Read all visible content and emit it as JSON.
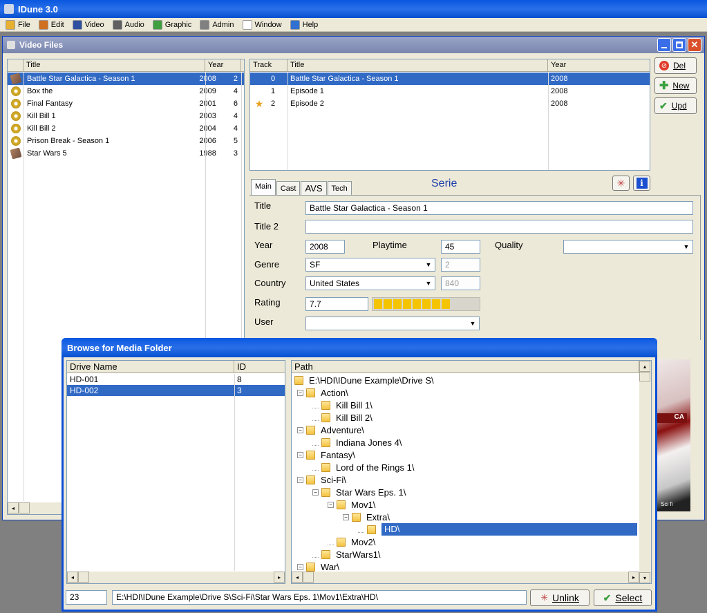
{
  "app": {
    "title": "IDune 3.0"
  },
  "menu": [
    {
      "label": "File",
      "icon": "folder-icon",
      "color": "#e8b030"
    },
    {
      "label": "Edit",
      "icon": "edit-icon",
      "color": "#d07020"
    },
    {
      "label": "Video",
      "icon": "film-icon",
      "color": "#3050a0"
    },
    {
      "label": "Audio",
      "icon": "music-icon",
      "color": "#606060"
    },
    {
      "label": "Graphic",
      "icon": "image-icon",
      "color": "#40a040"
    },
    {
      "label": "Admin",
      "icon": "tools-icon",
      "color": "#808080"
    },
    {
      "label": "Window",
      "icon": "window-icon",
      "color": "#ffffff"
    },
    {
      "label": "Help",
      "icon": "help-icon",
      "color": "#3070d0"
    }
  ],
  "video_window": {
    "title": "Video Files"
  },
  "video_list": {
    "headers": [
      "Title",
      "Year",
      ""
    ],
    "rows": [
      {
        "title": "Battle Star Galactica - Season 1",
        "year": "2008",
        "extra": "2",
        "icon": "hdd-icon",
        "selected": true
      },
      {
        "title": "Box the",
        "year": "2009",
        "extra": "4",
        "icon": "disc-icon",
        "selected": false
      },
      {
        "title": "Final Fantasy",
        "year": "2001",
        "extra": "6",
        "icon": "disc-icon",
        "selected": false
      },
      {
        "title": "Kill Bill 1",
        "year": "2003",
        "extra": "4",
        "icon": "disc-icon",
        "selected": false
      },
      {
        "title": "Kill Bill 2",
        "year": "2004",
        "extra": "4",
        "icon": "disc-icon",
        "selected": false
      },
      {
        "title": "Prison Break - Season 1",
        "year": "2006",
        "extra": "5",
        "icon": "disc-icon",
        "selected": false
      },
      {
        "title": "Star Wars 5",
        "year": "1988",
        "extra": "3",
        "icon": "hdd-icon",
        "selected": false
      }
    ]
  },
  "track_list": {
    "headers": [
      "Track",
      "Title",
      "Year"
    ],
    "rows": [
      {
        "track": "0",
        "title": "Battle Star Galactica - Season 1",
        "year": "2008",
        "selected": true,
        "star": false
      },
      {
        "track": "1",
        "title": "Episode 1",
        "year": "2008",
        "selected": false,
        "star": false
      },
      {
        "track": "2",
        "title": "Episode 2",
        "year": "2008",
        "selected": false,
        "star": true
      }
    ]
  },
  "buttons": {
    "del": "Del",
    "new": "New",
    "upd": "Upd"
  },
  "tabs": [
    "Main",
    "Cast",
    "AVS",
    "Tech"
  ],
  "serie_label": "Serie",
  "form": {
    "title_label": "Title",
    "title_value": "Battle Star Galactica - Season 1",
    "title2_label": "Title 2",
    "title2_value": "",
    "year_label": "Year",
    "year_value": "2008",
    "playtime_label": "Playtime",
    "playtime_value": "45",
    "quality_label": "Quality",
    "quality_value": "",
    "genre_label": "Genre",
    "genre_value": "SF",
    "genre_id": "2",
    "country_label": "Country",
    "country_value": "United States",
    "country_id": "840",
    "rating_label": "Rating",
    "rating_value": "7.7",
    "rating_fraction": 0.77,
    "user_label": "User",
    "user_value": ""
  },
  "dialog": {
    "title": "Browse for Media Folder",
    "drive_headers": [
      "Drive Name",
      "ID"
    ],
    "drives": [
      {
        "name": "HD-001",
        "id": "8",
        "selected": false
      },
      {
        "name": "HD-002",
        "id": "3",
        "selected": true
      }
    ],
    "path_header": "Path",
    "tree": [
      {
        "label": "E:\\HDI\\IDune Example\\Drive S\\",
        "level": 0,
        "pm": "",
        "selected": false
      },
      {
        "label": "Action\\",
        "level": 1,
        "pm": "-",
        "selected": false
      },
      {
        "label": "Kill Bill 1\\",
        "level": 2,
        "pm": "",
        "selected": false
      },
      {
        "label": "Kill Bill 2\\",
        "level": 2,
        "pm": "",
        "selected": false
      },
      {
        "label": "Adventure\\",
        "level": 1,
        "pm": "-",
        "selected": false
      },
      {
        "label": "Indiana Jones 4\\",
        "level": 2,
        "pm": "",
        "selected": false
      },
      {
        "label": "Fantasy\\",
        "level": 1,
        "pm": "-",
        "selected": false
      },
      {
        "label": "Lord of the Rings 1\\",
        "level": 2,
        "pm": "",
        "selected": false
      },
      {
        "label": "Sci-Fi\\",
        "level": 1,
        "pm": "-",
        "selected": false
      },
      {
        "label": "Star Wars Eps. 1\\",
        "level": 2,
        "pm": "-",
        "selected": false
      },
      {
        "label": "Mov1\\",
        "level": 3,
        "pm": "-",
        "selected": false
      },
      {
        "label": "Extra\\",
        "level": 4,
        "pm": "-",
        "selected": false
      },
      {
        "label": "HD\\",
        "level": 5,
        "pm": "",
        "selected": true
      },
      {
        "label": "Mov2\\",
        "level": 3,
        "pm": "",
        "selected": false
      },
      {
        "label": "StarWars1\\",
        "level": 2,
        "pm": "",
        "selected": false
      },
      {
        "label": "War\\",
        "level": 1,
        "pm": "-",
        "selected": false
      }
    ],
    "id_value": "23",
    "path_value": "E:\\HDI\\IDune Example\\Drive S\\Sci-Fi\\Star Wars Eps. 1\\Mov1\\Extra\\HD\\",
    "unlink": "Unlink",
    "select": "Select"
  },
  "poster_text": "Sci fi"
}
